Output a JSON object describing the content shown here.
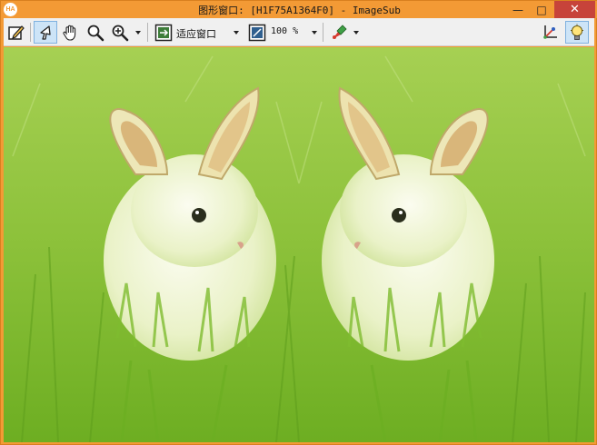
{
  "window": {
    "app_icon_text": "HA",
    "title": "图形窗口: [H1F75A1364F0] - ImageSub",
    "minimize_glyph": "—",
    "maximize_glyph": "□",
    "close_glyph": "✕"
  },
  "toolbar": {
    "fit_label": "适应窗口",
    "zoom_label": "100 %",
    "icons": [
      "edit-icon",
      "pointer-icon",
      "hand-icon",
      "magnifier-icon",
      "zoom-in-icon",
      "fit-window-icon",
      "zoom-percent-icon",
      "color-palette-icon",
      "axes-icon",
      "lightbulb-icon"
    ]
  },
  "image": {
    "subject": "two mirrored white rabbits on green grass",
    "colors": {
      "grass": "#8DC23A",
      "rabbit": "#F1F6D9",
      "ear_inner": "#D9B67A"
    }
  },
  "colors": {
    "title_bar": "#F39A35",
    "toolbar": "#F0F0F0",
    "close_button": "#C7433A",
    "active_tool": "#CDE4F7"
  }
}
